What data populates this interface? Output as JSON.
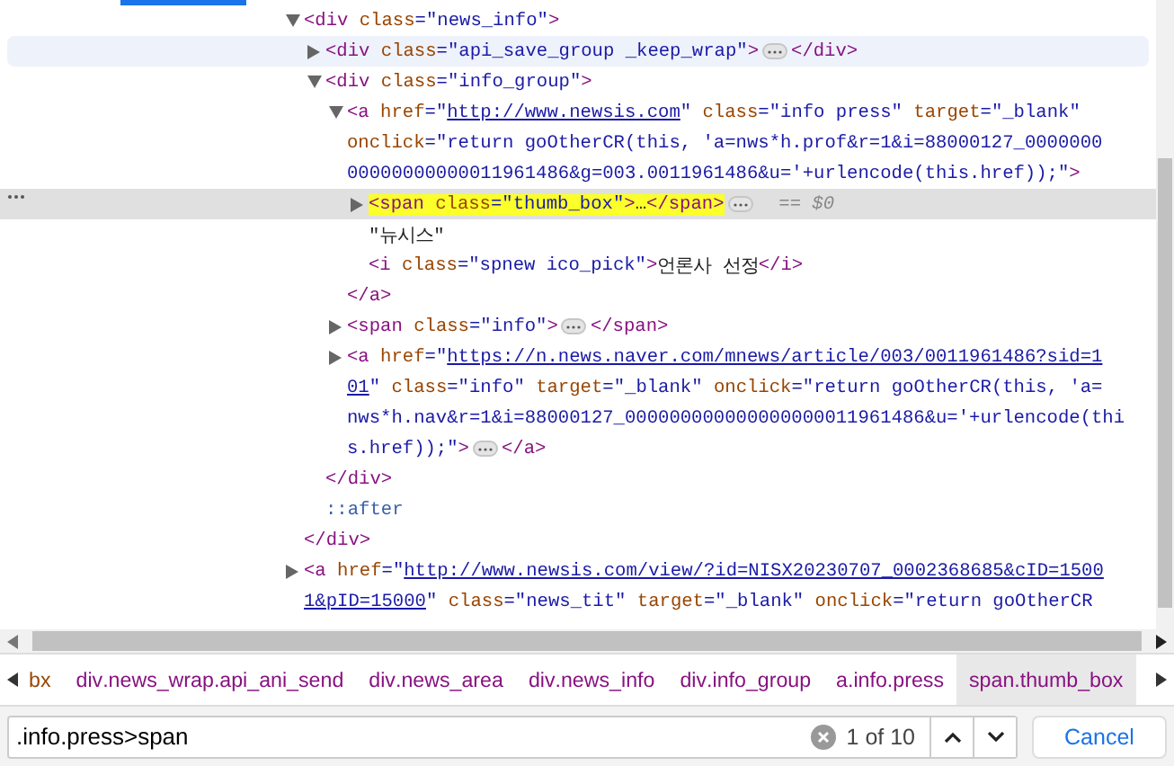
{
  "tree": [
    {
      "expandable": true,
      "expanded": true,
      "selected": false,
      "hovered": false,
      "lines": [
        [
          {
            "kind": "tag",
            "t": "<div"
          },
          {
            "kind": "attr",
            "t": " class"
          },
          {
            "kind": "value",
            "t": "=\"news_info\""
          },
          {
            "kind": "tag",
            "t": ">"
          }
        ]
      ],
      "closing": [
        [
          {
            "kind": "tag",
            "t": "</div>"
          }
        ]
      ],
      "children": [
        {
          "expandable": true,
          "expanded": false,
          "selected": false,
          "hovered": true,
          "lines": [
            [
              {
                "kind": "tag",
                "t": "<div"
              },
              {
                "kind": "attr",
                "t": " class"
              },
              {
                "kind": "value",
                "t": "=\"api_save_group _keep_wrap\""
              },
              {
                "kind": "tag",
                "t": ">"
              },
              {
                "kind": "more"
              },
              {
                "kind": "tag",
                "t": "</div>"
              }
            ]
          ]
        },
        {
          "expandable": true,
          "expanded": true,
          "selected": false,
          "hovered": false,
          "lines": [
            [
              {
                "kind": "tag",
                "t": "<div"
              },
              {
                "kind": "attr",
                "t": " class"
              },
              {
                "kind": "value",
                "t": "=\"info_group\""
              },
              {
                "kind": "tag",
                "t": ">"
              }
            ]
          ],
          "closing": [
            [
              {
                "kind": "tag",
                "t": "</div>"
              }
            ]
          ],
          "children": [
            {
              "expandable": true,
              "expanded": true,
              "selected": false,
              "hovered": false,
              "lines": [
                [
                  {
                    "kind": "tag",
                    "t": "<a"
                  },
                  {
                    "kind": "attr",
                    "t": " href"
                  },
                  {
                    "kind": "value",
                    "t": "=\""
                  },
                  {
                    "kind": "link",
                    "t": "http://www.newsis.com"
                  },
                  {
                    "kind": "value",
                    "t": "\""
                  },
                  {
                    "kind": "attr",
                    "t": " class"
                  },
                  {
                    "kind": "value",
                    "t": "=\"info press\""
                  },
                  {
                    "kind": "attr",
                    "t": " target"
                  },
                  {
                    "kind": "value",
                    "t": "=\"_blank\""
                  }
                ],
                [
                  {
                    "kind": "attr",
                    "t": "onclick"
                  },
                  {
                    "kind": "value",
                    "t": "=\"return goOtherCR(this, 'a=nws*h.prof&r=1&i=88000127_0000000"
                  }
                ],
                [
                  {
                    "kind": "value",
                    "t": "00000000000011961486&g=003.0011961486&u='+urlencode(this.href));\""
                  },
                  {
                    "kind": "tag",
                    "t": ">"
                  }
                ]
              ],
              "closing": [
                [
                  {
                    "kind": "tag",
                    "t": "</a>"
                  }
                ]
              ],
              "children": [
                {
                  "expandable": true,
                  "expanded": false,
                  "selected": true,
                  "hovered": false,
                  "lines": [
                    [
                      {
                        "kind": "match",
                        "parts": [
                          {
                            "kind": "tag",
                            "t": "<span"
                          },
                          {
                            "kind": "attr",
                            "t": " class"
                          },
                          {
                            "kind": "value",
                            "t": "=\"thumb_box\""
                          },
                          {
                            "kind": "tag",
                            "t": ">"
                          },
                          {
                            "kind": "text",
                            "t": "…"
                          },
                          {
                            "kind": "tag",
                            "t": "</span>"
                          }
                        ]
                      },
                      {
                        "kind": "more"
                      },
                      {
                        "kind": "note",
                        "t": "== $0"
                      }
                    ]
                  ]
                },
                {
                  "expandable": false,
                  "selected": false,
                  "hovered": false,
                  "lines": [
                    [
                      {
                        "kind": "text",
                        "t": "\"뉴시스\""
                      }
                    ]
                  ]
                },
                {
                  "expandable": false,
                  "selected": false,
                  "hovered": false,
                  "lines": [
                    [
                      {
                        "kind": "tag",
                        "t": "<i"
                      },
                      {
                        "kind": "attr",
                        "t": " class"
                      },
                      {
                        "kind": "value",
                        "t": "=\"spnew ico_pick\""
                      },
                      {
                        "kind": "tag",
                        "t": ">"
                      },
                      {
                        "kind": "text",
                        "t": "언론사 선정"
                      },
                      {
                        "kind": "tag",
                        "t": "</i>"
                      }
                    ]
                  ]
                }
              ]
            },
            {
              "expandable": true,
              "expanded": false,
              "selected": false,
              "hovered": false,
              "lines": [
                [
                  {
                    "kind": "tag",
                    "t": "<span"
                  },
                  {
                    "kind": "attr",
                    "t": " class"
                  },
                  {
                    "kind": "value",
                    "t": "=\"info\""
                  },
                  {
                    "kind": "tag",
                    "t": ">"
                  },
                  {
                    "kind": "more"
                  },
                  {
                    "kind": "tag",
                    "t": "</span>"
                  }
                ]
              ]
            },
            {
              "expandable": true,
              "expanded": false,
              "selected": false,
              "hovered": false,
              "lines": [
                [
                  {
                    "kind": "tag",
                    "t": "<a"
                  },
                  {
                    "kind": "attr",
                    "t": " href"
                  },
                  {
                    "kind": "value",
                    "t": "=\""
                  },
                  {
                    "kind": "link",
                    "t": "https://n.news.naver.com/mnews/article/003/0011961486?sid=1"
                  }
                ],
                [
                  {
                    "kind": "link",
                    "t": "01"
                  },
                  {
                    "kind": "value",
                    "t": "\""
                  },
                  {
                    "kind": "attr",
                    "t": " class"
                  },
                  {
                    "kind": "value",
                    "t": "=\"info\""
                  },
                  {
                    "kind": "attr",
                    "t": " target"
                  },
                  {
                    "kind": "value",
                    "t": "=\"_blank\""
                  },
                  {
                    "kind": "attr",
                    "t": " onclick"
                  },
                  {
                    "kind": "value",
                    "t": "=\"return goOtherCR(this, 'a="
                  }
                ],
                [
                  {
                    "kind": "value",
                    "t": "nws*h.nav&r=1&i=88000127_000000000000000000011961486&u='+urlencode(thi"
                  }
                ],
                [
                  {
                    "kind": "value",
                    "t": "s.href));\""
                  },
                  {
                    "kind": "tag",
                    "t": ">"
                  },
                  {
                    "kind": "more"
                  },
                  {
                    "kind": "tag",
                    "t": "</a>"
                  }
                ]
              ]
            }
          ]
        },
        {
          "expandable": false,
          "selected": false,
          "hovered": false,
          "lines": [
            [
              {
                "kind": "pseudo",
                "t": "::after"
              }
            ]
          ]
        }
      ]
    },
    {
      "expandable": true,
      "expanded": false,
      "selected": false,
      "hovered": false,
      "lines": [
        [
          {
            "kind": "tag",
            "t": "<a"
          },
          {
            "kind": "attr",
            "t": " href"
          },
          {
            "kind": "value",
            "t": "=\""
          },
          {
            "kind": "link",
            "t": "http://www.newsis.com/view/?id=NISX20230707_0002368685&cID=1500"
          }
        ],
        [
          {
            "kind": "link",
            "t": "1&pID=15000"
          },
          {
            "kind": "value",
            "t": "\""
          },
          {
            "kind": "attr",
            "t": " class"
          },
          {
            "kind": "value",
            "t": "=\"news_tit\""
          },
          {
            "kind": "attr",
            "t": " target"
          },
          {
            "kind": "value",
            "t": "=\"_blank\""
          },
          {
            "kind": "attr",
            "t": " onclick"
          },
          {
            "kind": "value",
            "t": "=\"return goOtherCR"
          }
        ]
      ]
    }
  ],
  "breadcrumbs": [
    {
      "cls": "bx",
      "selected": false
    },
    {
      "tag": "div",
      "cls": ".news_wrap.api_ani_send",
      "selected": false
    },
    {
      "tag": "div",
      "cls": ".news_area",
      "selected": false
    },
    {
      "tag": "div",
      "cls": ".news_info",
      "selected": false
    },
    {
      "tag": "div",
      "cls": ".info_group",
      "selected": false
    },
    {
      "tag": "a",
      "cls": ".info.press",
      "selected": false
    },
    {
      "tag": "span",
      "cls": ".thumb_box",
      "selected": true
    }
  ],
  "search": {
    "value": ".info.press>span",
    "count": "1 of 10",
    "cancel": "Cancel"
  }
}
